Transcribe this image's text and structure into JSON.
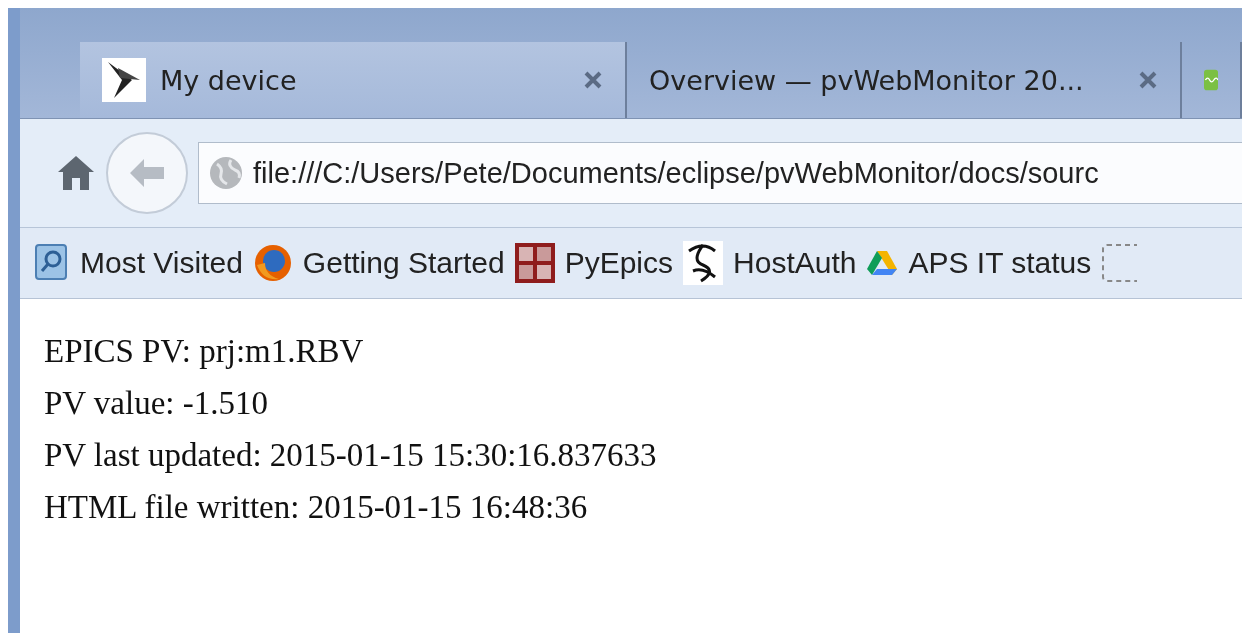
{
  "tabs": [
    {
      "kind": "page",
      "label": "My device",
      "selected": true
    },
    {
      "kind": "page",
      "label": "Overview — pvWebMonitor 20...",
      "selected": false
    },
    {
      "kind": "icon",
      "selected": false
    }
  ],
  "toolbar": {
    "address": "file:///C:/Users/Pete/Documents/eclipse/pvWebMonitor/docs/sourc"
  },
  "bookmarks": [
    {
      "kind": "link",
      "label": "Most Visited"
    },
    {
      "kind": "link",
      "label": "Getting Started"
    },
    {
      "kind": "link",
      "label": "PyEpics"
    },
    {
      "kind": "link",
      "label": "HostAuth"
    },
    {
      "kind": "link",
      "label": "APS IT status"
    },
    {
      "kind": "icon"
    }
  ],
  "content": {
    "lines": [
      "EPICS PV: prj:m1.RBV",
      "PV value: -1.510",
      "PV last updated: 2015-01-15 15:30:16.837633",
      "HTML file written: 2015-01-15 16:48:36"
    ]
  }
}
